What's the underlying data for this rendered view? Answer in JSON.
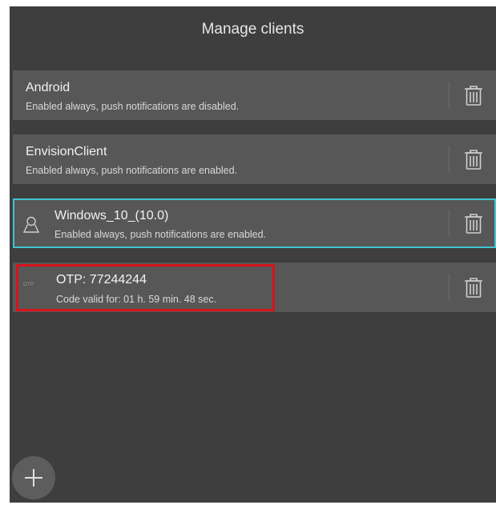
{
  "header": {
    "title": "Manage clients"
  },
  "clients": [
    {
      "name": "Android",
      "status": "Enabled always, push notifications are disabled."
    },
    {
      "name": "EnvisionClient",
      "status": "Enabled always, push notifications are enabled."
    },
    {
      "name": "Windows_10_(10.0)",
      "status": "Enabled always, push notifications are enabled.",
      "icon": "user-icon"
    }
  ],
  "otp": {
    "badge": "OTP",
    "code_label": "OTP: 77244244",
    "validity": "Code valid for: 01 h. 59 min. 48 sec."
  },
  "icons": {
    "delete": "trash-icon",
    "add": "plus-icon"
  },
  "colors": {
    "background": "#3e3e3e",
    "row": "#575757",
    "selected_border": "#3fc5d2",
    "highlight_border": "#d7141a"
  }
}
